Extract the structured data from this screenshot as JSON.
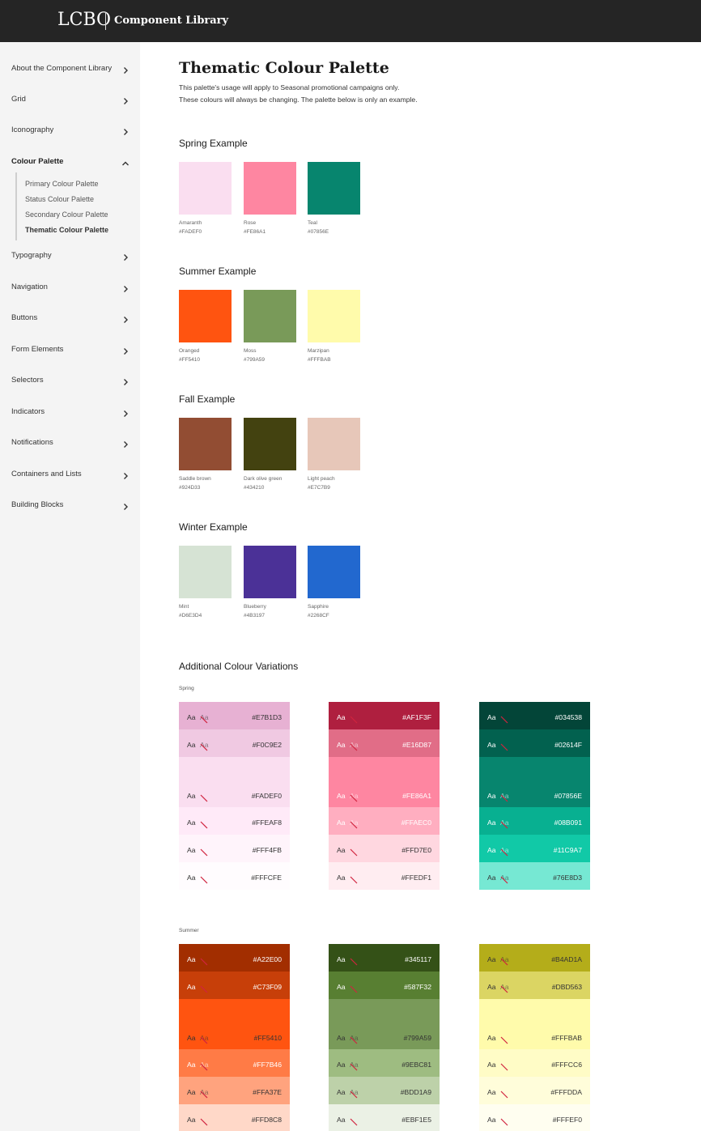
{
  "header": {
    "logo": "LCBO",
    "title": "Component Library"
  },
  "sidebar": {
    "items": [
      {
        "label": "About the Component Library",
        "state": "collapsed"
      },
      {
        "label": "Grid",
        "state": "collapsed"
      },
      {
        "label": "Iconography",
        "state": "collapsed"
      },
      {
        "label": "Colour Palette",
        "state": "expanded"
      },
      {
        "label": "Typography",
        "state": "collapsed"
      },
      {
        "label": "Navigation",
        "state": "collapsed"
      },
      {
        "label": "Buttons",
        "state": "collapsed"
      },
      {
        "label": "Form Elements",
        "state": "collapsed"
      },
      {
        "label": "Selectors",
        "state": "collapsed"
      },
      {
        "label": "Indicators",
        "state": "collapsed"
      },
      {
        "label": "Notifications",
        "state": "collapsed"
      },
      {
        "label": "Containers and Lists",
        "state": "collapsed"
      },
      {
        "label": "Building Blocks",
        "state": "collapsed"
      }
    ],
    "subitems": [
      {
        "label": "Primary Colour Palette",
        "current": false
      },
      {
        "label": "Status Colour Palette",
        "current": false
      },
      {
        "label": "Secondary Colour Palette",
        "current": false
      },
      {
        "label": "Thematic Colour Palette",
        "current": true
      }
    ]
  },
  "page": {
    "title": "Thematic Colour Palette",
    "intro": [
      "This palette's usage will apply to Seasonal promotional campaigns only.",
      "These colours will always be changing. The palette below is only an example."
    ]
  },
  "examples": [
    {
      "title": "Spring Example",
      "swatches": [
        {
          "name": "Amaranth",
          "hex": "#FADEF0"
        },
        {
          "name": "Rose",
          "hex": "#FE86A1"
        },
        {
          "name": "Teal",
          "hex": "#07856E"
        }
      ]
    },
    {
      "title": "Summer Example",
      "swatches": [
        {
          "name": "Oranged",
          "hex": "#FF5410"
        },
        {
          "name": "Moss",
          "hex": "#799A59"
        },
        {
          "name": "Marzipan",
          "hex": "#FFFBAB"
        }
      ]
    },
    {
      "title": "Fall Example",
      "swatches": [
        {
          "name": "Saddle brown",
          "hex": "#924D33"
        },
        {
          "name": "Dark olive green",
          "hex": "#434210"
        },
        {
          "name": "Light peach",
          "hex": "#E7C7B9"
        }
      ]
    },
    {
      "title": "Winter Example",
      "swatches": [
        {
          "name": "Mint",
          "hex": "#D6E3D4"
        },
        {
          "name": "Blueberry",
          "hex": "#4B3197"
        },
        {
          "name": "Sapphire",
          "hex": "#2268CF"
        }
      ]
    }
  ],
  "variations": {
    "title": "Additional Colour Variations",
    "groups": [
      {
        "label": "Spring",
        "columns": [
          [
            {
              "hex": "#E7B1D3",
              "text": "#333333",
              "aa": "Aa",
              "alt": "Aa"
            },
            {
              "hex": "#F0C9E2",
              "text": "#333333",
              "aa": "Aa",
              "alt": "Aa"
            },
            {
              "hex": "#FADEF0",
              "text": "#333333",
              "aa": "Aa",
              "alt": ""
            },
            {
              "hex": "#FFEAF8",
              "text": "#333333",
              "aa": "Aa",
              "alt": ""
            },
            {
              "hex": "#FFF4FB",
              "text": "#333333",
              "aa": "Aa",
              "alt": ""
            },
            {
              "hex": "#FFFCFE",
              "text": "#333333",
              "aa": "Aa",
              "alt": ""
            }
          ],
          [
            {
              "hex": "#AF1F3F",
              "text": "#ffffff",
              "aa": "Aa",
              "alt": ""
            },
            {
              "hex": "#E16D87",
              "text": "#ffffff",
              "aa": "Aa",
              "alt": "Aa"
            },
            {
              "hex": "#FE86A1",
              "text": "#ffffff",
              "aa": "Aa",
              "alt": "Aa"
            },
            {
              "hex": "#FFAEC0",
              "text": "#ffffff",
              "aa": "Aa",
              "alt": "Aa"
            },
            {
              "hex": "#FFD7E0",
              "text": "#333333",
              "aa": "Aa",
              "alt": ""
            },
            {
              "hex": "#FFEDF1",
              "text": "#333333",
              "aa": "Aa",
              "alt": ""
            }
          ],
          [
            {
              "hex": "#034538",
              "text": "#ffffff",
              "aa": "Aa",
              "alt": ""
            },
            {
              "hex": "#02614F",
              "text": "#ffffff",
              "aa": "Aa",
              "alt": ""
            },
            {
              "hex": "#07856E",
              "text": "#ffffff",
              "aa": "Aa",
              "alt": "Aa"
            },
            {
              "hex": "#08B091",
              "text": "#ffffff",
              "aa": "Aa",
              "alt": "Aa"
            },
            {
              "hex": "#11C9A7",
              "text": "#ffffff",
              "aa": "Aa",
              "alt": "Aa"
            },
            {
              "hex": "#76E8D3",
              "text": "#333333",
              "aa": "Aa",
              "alt": "Aa"
            }
          ]
        ]
      },
      {
        "label": "Summer",
        "columns": [
          [
            {
              "hex": "#A22E00",
              "text": "#ffffff",
              "aa": "Aa",
              "alt": ""
            },
            {
              "hex": "#C73F09",
              "text": "#ffffff",
              "aa": "Aa",
              "alt": ""
            },
            {
              "hex": "#FF5410",
              "text": "#333333",
              "aa": "Aa",
              "alt": "Aa"
            },
            {
              "hex": "#FF7B46",
              "text": "#ffffff",
              "aa": "Aa",
              "alt": "Aa"
            },
            {
              "hex": "#FFA37E",
              "text": "#333333",
              "aa": "Aa",
              "alt": "Aa"
            },
            {
              "hex": "#FFD8C8",
              "text": "#333333",
              "aa": "Aa",
              "alt": ""
            }
          ],
          [
            {
              "hex": "#345117",
              "text": "#ffffff",
              "aa": "Aa",
              "alt": ""
            },
            {
              "hex": "#587F32",
              "text": "#ffffff",
              "aa": "Aa",
              "alt": ""
            },
            {
              "hex": "#799A59",
              "text": "#333333",
              "aa": "Aa",
              "alt": "Aa"
            },
            {
              "hex": "#9EBC81",
              "text": "#333333",
              "aa": "Aa",
              "alt": "Aa"
            },
            {
              "hex": "#BDD1A9",
              "text": "#333333",
              "aa": "Aa",
              "alt": "Aa"
            },
            {
              "hex": "#EBF1E5",
              "text": "#333333",
              "aa": "Aa",
              "alt": ""
            }
          ],
          [
            {
              "hex": "#B4AD1A",
              "text": "#333333",
              "aa": "Aa",
              "alt": "Aa"
            },
            {
              "hex": "#DBD563",
              "text": "#333333",
              "aa": "Aa",
              "alt": "Aa"
            },
            {
              "hex": "#FFFBAB",
              "text": "#333333",
              "aa": "Aa",
              "alt": ""
            },
            {
              "hex": "#FFFCC6",
              "text": "#333333",
              "aa": "Aa",
              "alt": ""
            },
            {
              "hex": "#FFFDDA",
              "text": "#333333",
              "aa": "Aa",
              "alt": ""
            },
            {
              "hex": "#FFFEF0",
              "text": "#333333",
              "aa": "Aa",
              "alt": ""
            }
          ]
        ]
      }
    ]
  },
  "icons": {
    "chevron_right": "chevron-right-icon",
    "chevron_up": "chevron-up-icon",
    "contrast_fail": "contrast-fail-icon"
  },
  "colors": {
    "topbar": "#252525",
    "sidebar": "#f4f4f4",
    "fail_stroke": "#d0243f"
  }
}
